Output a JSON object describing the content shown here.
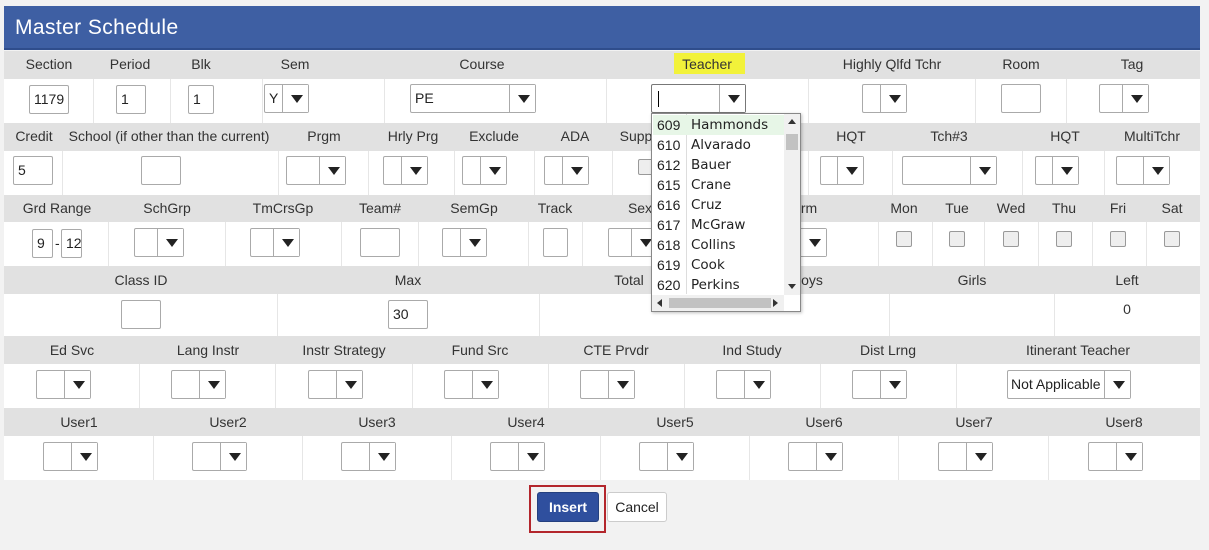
{
  "title": "Master Schedule",
  "row1": {
    "labels": [
      "Section",
      "Period",
      "Blk",
      "Sem",
      "Course",
      "Teacher",
      "Highly Qlfd Tchr",
      "Room",
      "Tag"
    ],
    "section": "1179",
    "period": "1",
    "blk": "1",
    "sem": "Y",
    "course": "PE",
    "teacher": "",
    "hqt": "",
    "room": "",
    "tag": ""
  },
  "row2": {
    "labels": [
      "Credit",
      "School (if other than the current)",
      "Prgm",
      "Hrly Prg",
      "Exclude",
      "ADA",
      "Supp",
      "HQT",
      "Tch#3",
      "HQT",
      "MultiTchr"
    ],
    "credit": "5",
    "school": ""
  },
  "row3": {
    "labels": [
      "Grd Range",
      "SchGrp",
      "TmCrsGp",
      "Team#",
      "SemGp",
      "Track",
      "Sex",
      "rm",
      "Mon",
      "Tue",
      "Wed",
      "Thu",
      "Fri",
      "Sat"
    ],
    "grd_from": "9",
    "grd_sep": "-",
    "grd_to": "12"
  },
  "row4": {
    "labels": [
      "Class ID",
      "Max",
      "Total",
      "oys",
      "Girls",
      "Left"
    ],
    "class_id": "",
    "max": "30",
    "left": "0"
  },
  "row5": {
    "labels": [
      "Ed Svc",
      "Lang Instr",
      "Instr Strategy",
      "Fund Src",
      "CTE Prvdr",
      "Ind Study",
      "Dist Lrng",
      "Itinerant Teacher"
    ],
    "itinerant": "Not Applicable"
  },
  "row6": {
    "labels": [
      "User1",
      "User2",
      "User3",
      "User4",
      "User5",
      "User6",
      "User7",
      "User8"
    ]
  },
  "teacher_dropdown": [
    {
      "num": "609",
      "name": "Hammonds"
    },
    {
      "num": "610",
      "name": "Alvarado"
    },
    {
      "num": "612",
      "name": "Bauer"
    },
    {
      "num": "615",
      "name": "Crane"
    },
    {
      "num": "616",
      "name": "Cruz"
    },
    {
      "num": "617",
      "name": "McGraw"
    },
    {
      "num": "618",
      "name": "Collins"
    },
    {
      "num": "619",
      "name": "Cook"
    },
    {
      "num": "620",
      "name": "Perkins"
    }
  ],
  "buttons": {
    "insert": "Insert",
    "cancel": "Cancel"
  },
  "colors": {
    "titlebar": "#3e5fa3",
    "insert": "#2f4f9e",
    "highlight": "#f2f23a",
    "focus_border": "#c0282e"
  }
}
